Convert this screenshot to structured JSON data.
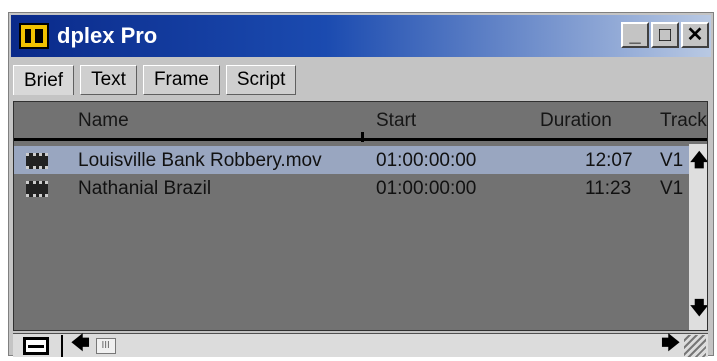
{
  "window": {
    "title": "dplex Pro",
    "controls": {
      "minimize": "_",
      "maximize": "□",
      "close": "✕"
    }
  },
  "tabs": [
    {
      "label": "Brief",
      "active": true
    },
    {
      "label": "Text",
      "active": false
    },
    {
      "label": "Frame",
      "active": false
    },
    {
      "label": "Script",
      "active": false
    }
  ],
  "table": {
    "columns": [
      "Name",
      "Start",
      "Duration",
      "Track"
    ],
    "rows": [
      {
        "name": "Louisville Bank Robbery.mov",
        "start": "01:00:00:00",
        "duration": "12:07",
        "track": "V1",
        "selected": true
      },
      {
        "name": "Nathanial Brazil",
        "start": "01:00:00:00",
        "duration": "11:23",
        "track": "V1",
        "selected": false
      }
    ]
  },
  "icons": {
    "app": "dplex-app-icon",
    "row": "film-clip-icon",
    "scroll_up": "up-arrow-icon",
    "scroll_down": "down-arrow-icon",
    "scroll_left": "left-arrow-icon",
    "scroll_right": "right-arrow-icon",
    "view_toggle": "list-view-icon",
    "resize": "resize-grip-icon"
  },
  "colors": {
    "titlebar_start": "#0a2a8a",
    "titlebar_end": "#b9c9e3",
    "list_background": "#727272",
    "selection": "#99a6c0"
  }
}
